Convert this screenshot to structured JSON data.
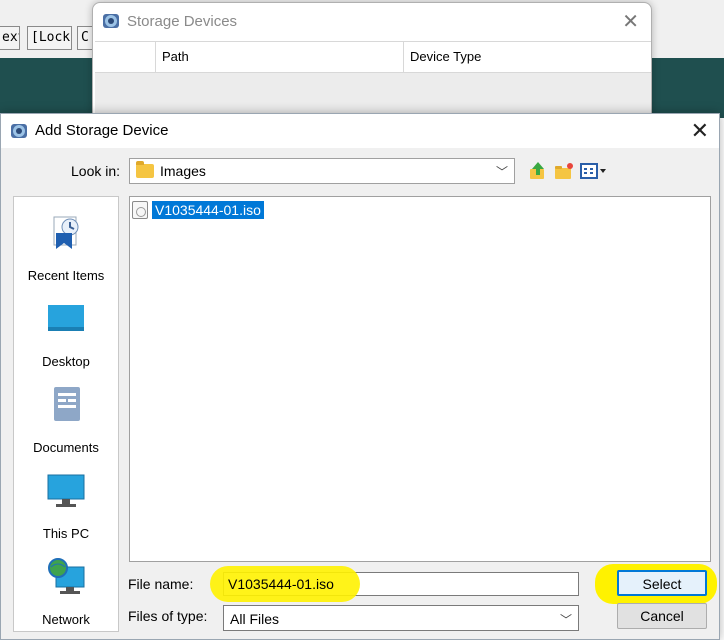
{
  "background": {
    "toolbar_buttons": [
      {
        "label": "ext"
      },
      {
        "label": "[Lock]"
      },
      {
        "label": "C"
      }
    ]
  },
  "storage_window": {
    "title": "Storage Devices",
    "columns": [
      "",
      "Path",
      "Device Type"
    ]
  },
  "dialog": {
    "title": "Add Storage Device",
    "look_in_label": "Look in:",
    "look_in_value": "Images",
    "tools": [
      "up-folder-icon",
      "new-folder-icon",
      "view-menu-icon"
    ],
    "places": [
      {
        "label": "Recent Items",
        "icon": "recent-items-icon"
      },
      {
        "label": "Desktop",
        "icon": "desktop-icon"
      },
      {
        "label": "Documents",
        "icon": "documents-icon"
      },
      {
        "label": "This PC",
        "icon": "this-pc-icon"
      },
      {
        "label": "Network",
        "icon": "network-icon"
      }
    ],
    "files": [
      {
        "name": "V1035444-01.iso",
        "selected": true
      }
    ],
    "file_name_label": "File name:",
    "file_name_value": "V1035444-01.iso",
    "files_of_type_label": "Files of type:",
    "files_of_type_value": "All Files",
    "select_label": "Select",
    "cancel_label": "Cancel"
  },
  "colors": {
    "highlight": "#fff200",
    "selection": "#0078d7",
    "teal_background": "#1f4f4f"
  }
}
